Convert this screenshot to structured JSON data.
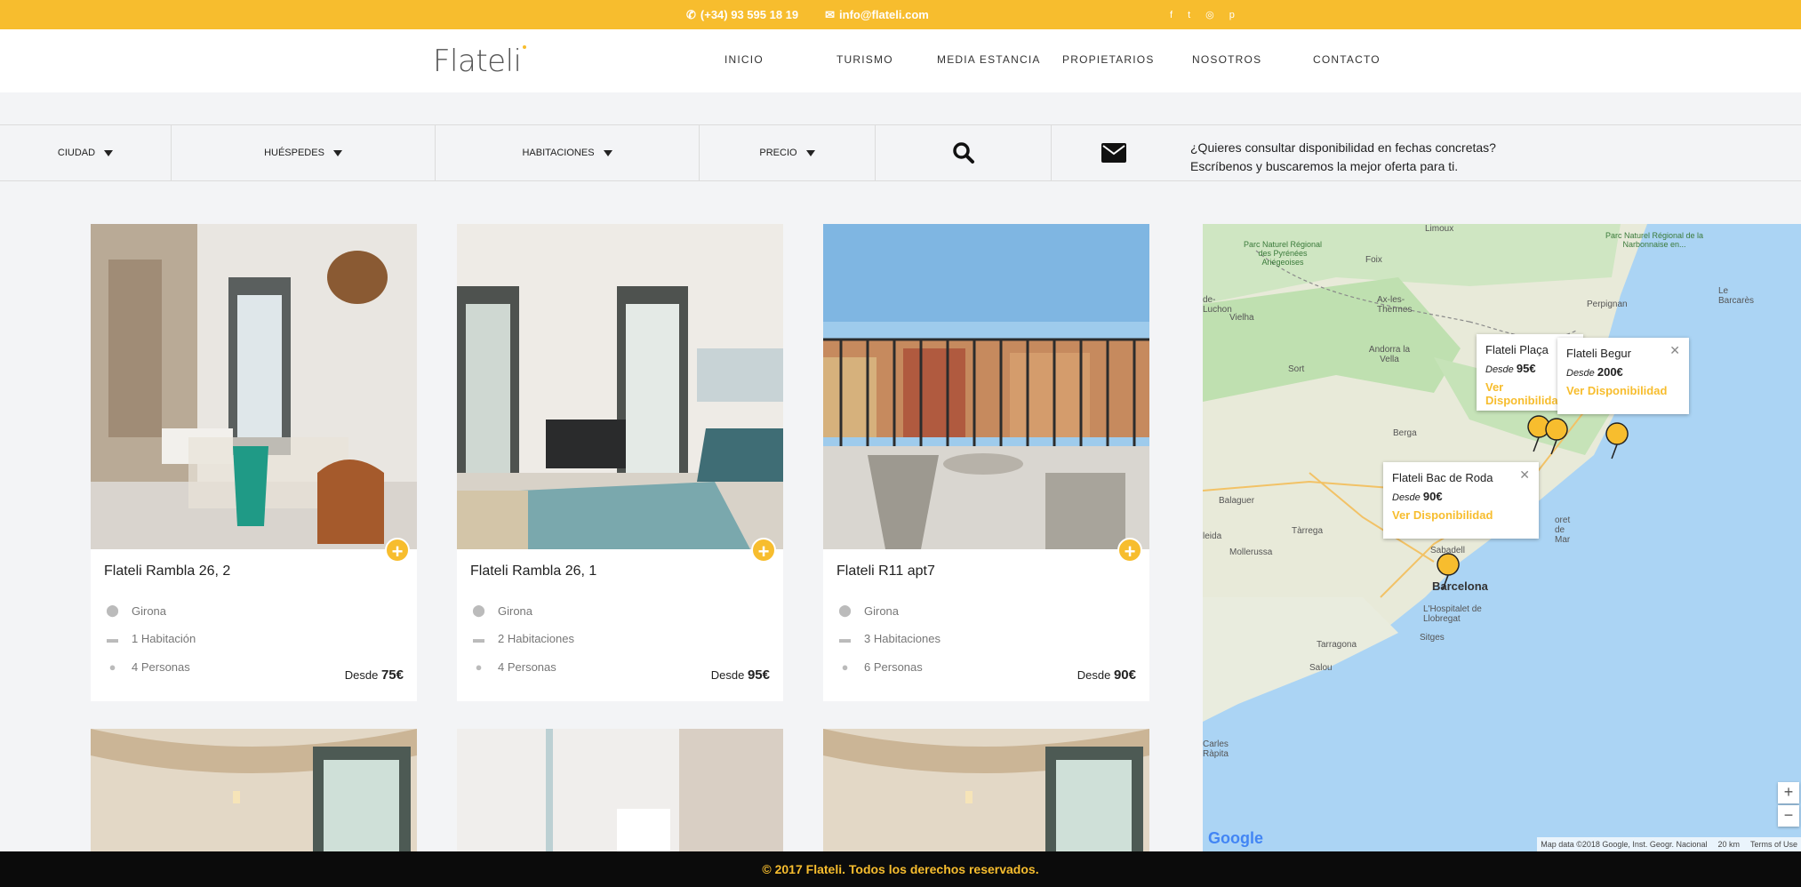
{
  "topbar": {
    "phone": "(+34) 93 595 18 19",
    "email": "info@flateli.com",
    "social": [
      "f",
      "t",
      "◎",
      "p"
    ]
  },
  "header": {
    "logo": "Flateli",
    "nav": [
      "INICIO",
      "TURISMO",
      "MEDIA ESTANCIA",
      "PROPIETARIOS",
      "NOSOTROS",
      "CONTACTO"
    ]
  },
  "filters": {
    "ciudad": "CIUDAD",
    "huespedes": "HUÉSPEDES",
    "habitaciones": "HABITACIONES",
    "precio": "PRECIO",
    "message_line1": "¿Quieres consultar disponibilidad en fechas concretas?",
    "message_line2": "Escríbenos y buscaremos la mejor oferta para ti."
  },
  "listings": [
    {
      "name": "Flateli Rambla 26, 2",
      "city": "Girona",
      "rooms": "1 Habitación",
      "guests": "4 Personas",
      "price_prefix": "Desde",
      "price": "75€"
    },
    {
      "name": "Flateli Rambla 26, 1",
      "city": "Girona",
      "rooms": "2 Habitaciones",
      "guests": "4 Personas",
      "price_prefix": "Desde",
      "price": "95€"
    },
    {
      "name": "Flateli R11 apt7",
      "city": "Girona",
      "rooms": "3 Habitaciones",
      "guests": "6 Personas",
      "price_prefix": "Desde",
      "price": "90€"
    }
  ],
  "map": {
    "popups": [
      {
        "title": "Flateli Plaça",
        "prefix": "Desde",
        "price": "95€",
        "link": "Ver Disponibilidad"
      },
      {
        "title": "Flateli Begur",
        "prefix": "Desde",
        "price": "200€",
        "link": "Ver Disponibilidad"
      },
      {
        "title": "Flateli Bac de Roda",
        "prefix": "Desde",
        "price": "90€",
        "link": "Ver Disponibilidad"
      }
    ],
    "labels": {
      "limoux": "Limoux",
      "parc": "Parc Naturel Régional de la Narbonnaise en...",
      "pyrenees": "Parc Naturel Régional des Pyrénées Ariégeoises",
      "foix": "Foix",
      "ax": "Ax-les-Thermes",
      "perpignan": "Perpignan",
      "barcares": "Le Barcarès",
      "luchon": "de-Luchon",
      "vielha": "Vielha",
      "andorra": "Andorra la Vella",
      "sort": "Sort",
      "berga": "Berga",
      "balaguer": "Balaguer",
      "lleida": "leida",
      "mollerussa": "Mollerussa",
      "tarrega": "Tàrrega",
      "sabadell": "Sabadell",
      "barcelona": "Barcelona",
      "hospitalet": "L'Hospitalet de Llobregat",
      "sitges": "Sitges",
      "tarragona": "Tarragona",
      "salou": "Salou",
      "carles": "Carles Ràpita",
      "mataro": "oret de Mar"
    },
    "attribution": "Map data ©2018 Google, Inst. Geogr. Nacional",
    "scale": "20 km",
    "terms": "Terms of Use",
    "google": "Google"
  },
  "footer": {
    "text": "© 2017 Flateli. Todos los derechos reservados."
  },
  "colors": {
    "accent": "#f7bd2e",
    "footer_bg": "#0b0b0b"
  }
}
